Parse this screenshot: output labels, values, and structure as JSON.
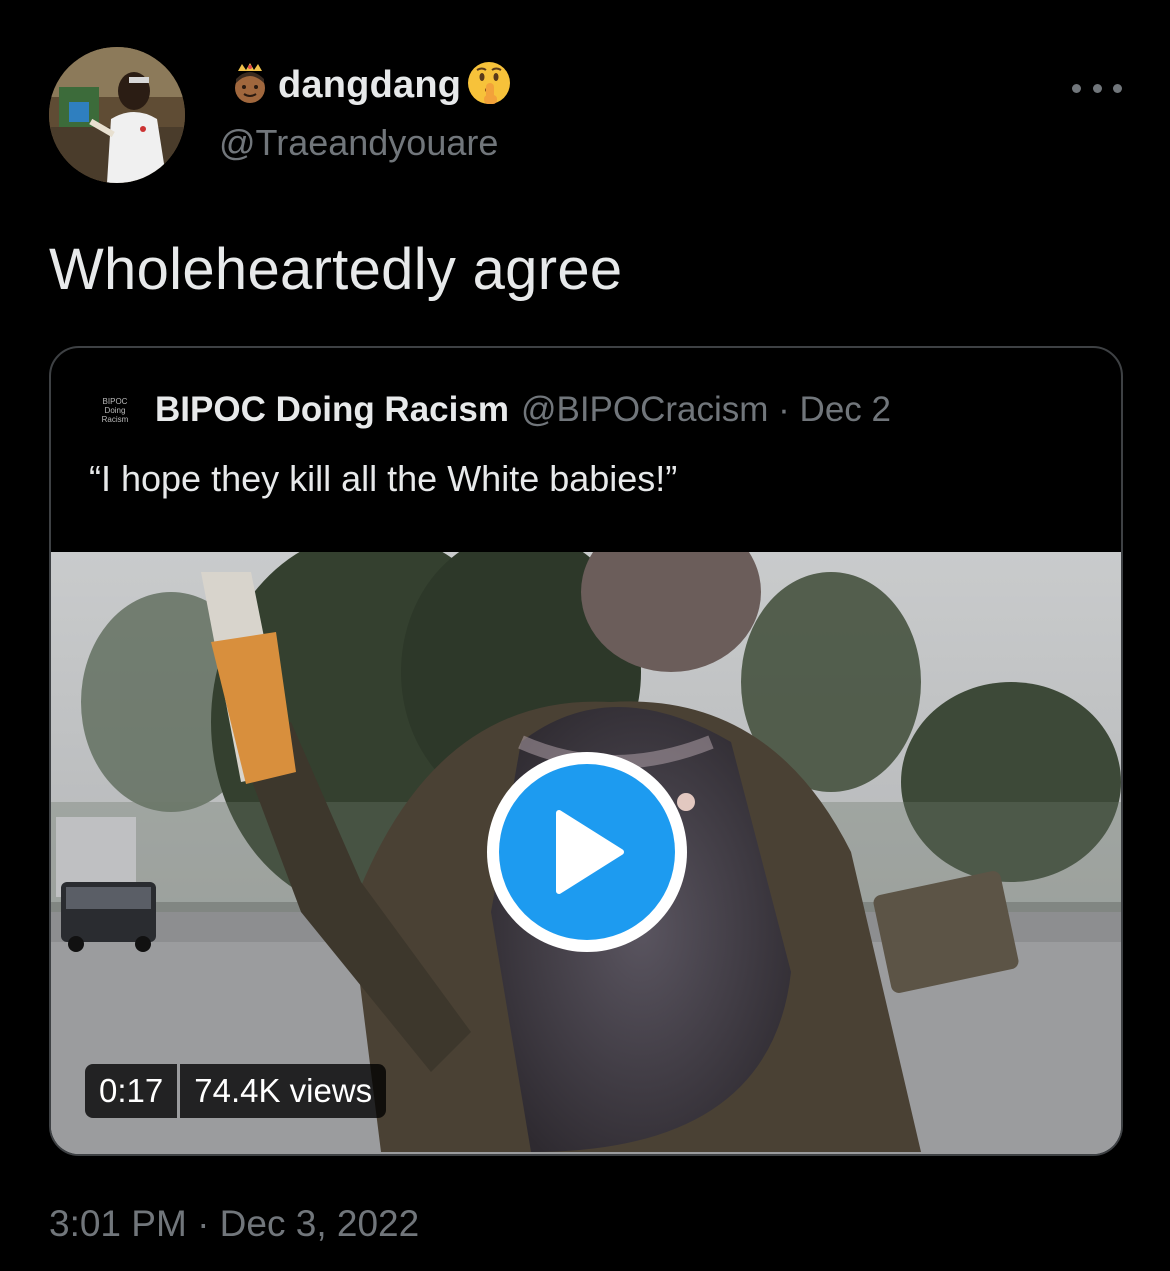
{
  "tweet": {
    "author": {
      "display_name": "dangdang",
      "handle": "@Traeandyouare",
      "name_emoji_left": "prince-emoji",
      "name_emoji_right": "shushing-face-emoji"
    },
    "text": "Wholeheartedly agree",
    "timestamp": "3:01 PM · Dec 3, 2022",
    "more_icon": "more-horizontal-icon"
  },
  "quoted": {
    "avatar_lines": [
      "BIPOC",
      "Doing",
      "Racism"
    ],
    "display_name": "BIPOC Doing Racism",
    "meta": "@BIPOCracism · Dec 2",
    "text": "“I hope they kill all the White babies!”",
    "video": {
      "duration": "0:17",
      "views": "74.4K views",
      "play_icon": "play-icon"
    }
  },
  "colors": {
    "background": "#000000",
    "primary_text": "#e7e9ea",
    "secondary_text": "#71767b",
    "border": "#3e4144",
    "accent": "#1d9bf0"
  }
}
